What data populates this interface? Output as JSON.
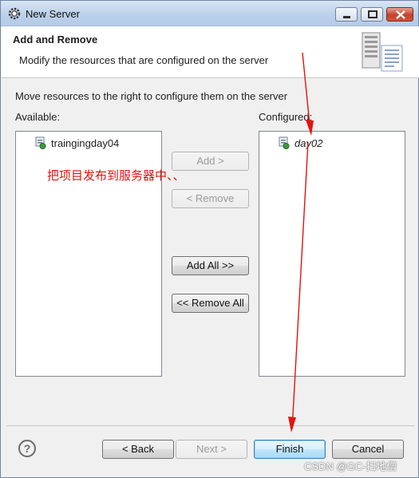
{
  "window": {
    "title": "New Server"
  },
  "header": {
    "title": "Add and Remove",
    "description": "Modify the resources that are configured on the server"
  },
  "body": {
    "intro": "Move resources to the right to configure them on the server",
    "available_label": "Available:",
    "configured_label": "Configured:",
    "available_items": [
      "traingingday04"
    ],
    "configured_items": [
      "day02"
    ]
  },
  "buttons": {
    "add": "Add >",
    "remove": "< Remove",
    "add_all": "Add All >>",
    "remove_all": "<< Remove All"
  },
  "footer": {
    "back": "< Back",
    "next": "Next >",
    "finish": "Finish",
    "cancel": "Cancel",
    "help": "?"
  },
  "annotation": "把项目发布到服务器中、、",
  "watermark": "CSDN @GC-扫地僧",
  "colors": {
    "annotation_arrow": "#e2140f",
    "title_bar": "#bcd1ea"
  }
}
